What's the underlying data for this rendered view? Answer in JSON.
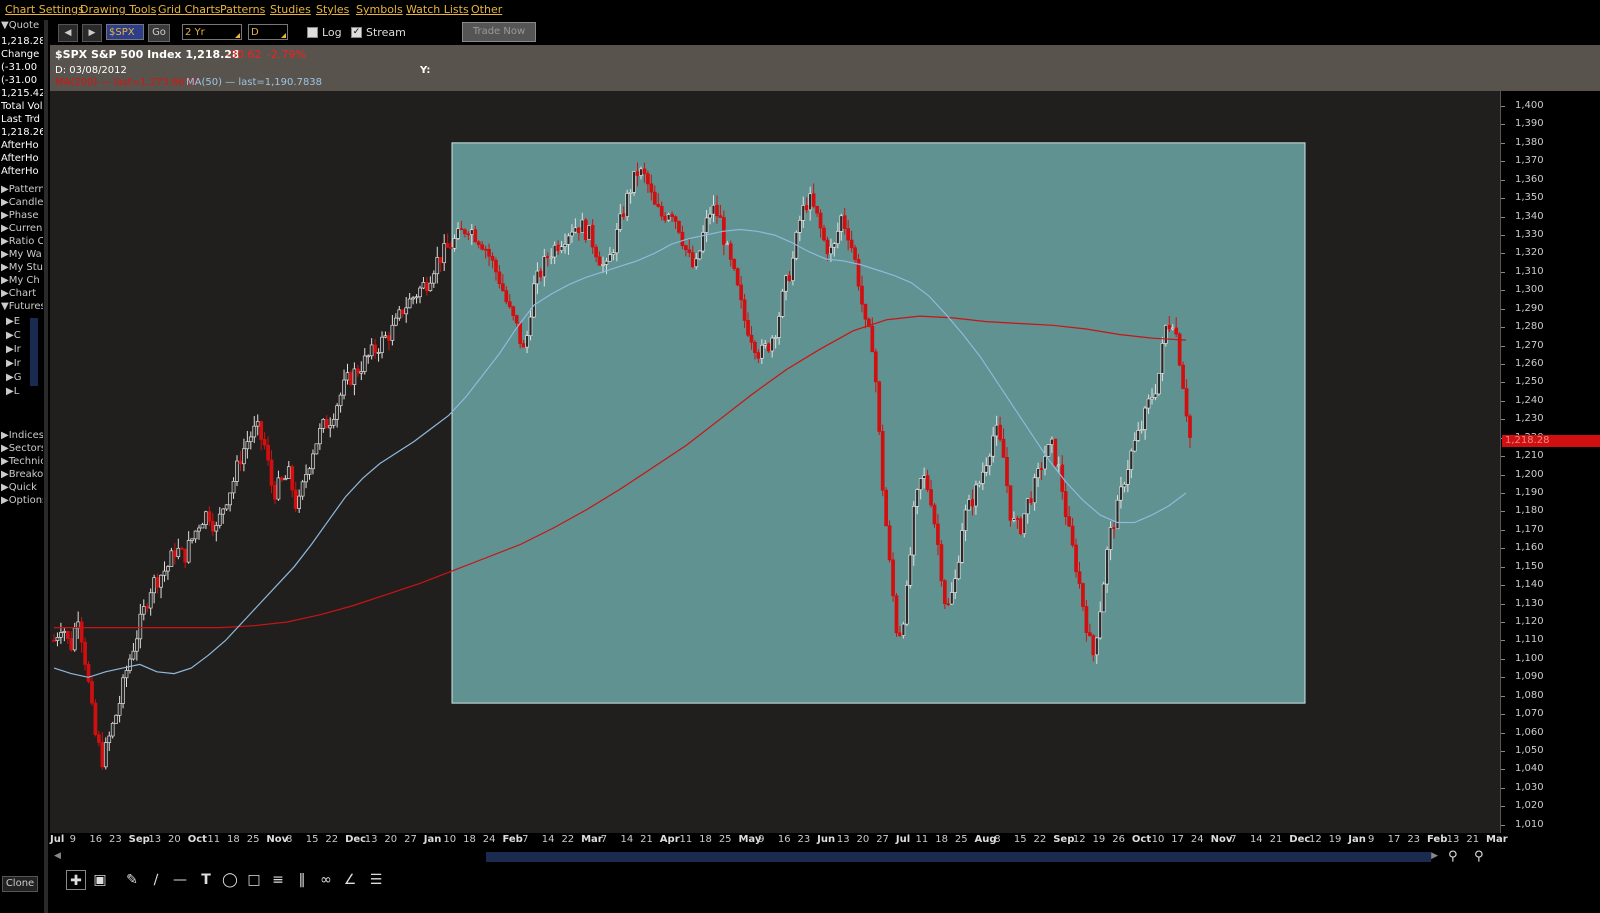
{
  "menu": [
    "Chart Settings",
    "Drawing Tools",
    "Grid Charts",
    "Patterns",
    "Studies",
    "Styles",
    "Symbols",
    "Watch Lists",
    "Other"
  ],
  "toolbar": {
    "symbol_value": "$SPX",
    "go_label": "Go",
    "range_value": "2 Yr",
    "period_value": "D",
    "log_label": "Log",
    "log_checked": false,
    "stream_label": "Stream",
    "stream_checked": true,
    "trade_label": "Trade Now"
  },
  "left_panel": {
    "quote_header": "Quote",
    "quote_rows": [
      "1,218.28",
      "Change",
      "(-31.00",
      "(-31.00",
      "1,215.42",
      "Total Vol",
      "Last Trd",
      "1,218.26",
      "AfterHo",
      "AfterHo",
      "AfterHo"
    ],
    "sections": [
      "Patterns",
      "Candle",
      "Phase",
      "Currency",
      "Ratio C",
      "My Wa",
      "My Stu",
      "My Ch",
      "Chart",
      "Futures"
    ],
    "futures_items": [
      "E",
      "C",
      "Ir",
      "Ir",
      "G",
      "L"
    ],
    "sections2": [
      "Indices",
      "Sectors",
      "Technic",
      "Breako",
      "Quick",
      "Options"
    ],
    "clone_label": "Clone"
  },
  "info": {
    "symbol_line": "$SPX S&P 500 Index  1,218.28",
    "change": "-30.62",
    "change_pct": "-2.79%",
    "date_line": "D: 03/08/2012",
    "y_label": "Y:",
    "ma200_label": "MA(200) — last=1,273.6632",
    "ma50_label": "MA(50) — last=1,190.7838"
  },
  "colors": {
    "up": "#e0e0e0",
    "down": "#d01010",
    "ma200": "#c81414",
    "ma50": "#8fb9dd",
    "highlight_box": "#5f9290",
    "chart_bg": "#211f1d"
  },
  "y_axis": {
    "ticks": [
      "1,400",
      "1,390",
      "1,380",
      "1,370",
      "1,360",
      "1,350",
      "1,340",
      "1,330",
      "1,320",
      "1,310",
      "1,300",
      "1,290",
      "1,280",
      "1,270",
      "1,260",
      "1,250",
      "1,240",
      "1,230",
      "1,220",
      "1,210",
      "1,200",
      "1,190",
      "1,180",
      "1,170",
      "1,160",
      "1,150",
      "1,140",
      "1,130",
      "1,120",
      "1,110",
      "1,100",
      "1,090",
      "1,080",
      "1,070",
      "1,060",
      "1,050",
      "1,040",
      "1,030",
      "1,020",
      "1,010"
    ],
    "last_value": "1,218.28"
  },
  "x_axis": {
    "labels": [
      {
        "t": "Jul",
        "m": true
      },
      {
        "t": "9"
      },
      {
        "t": "16"
      },
      {
        "t": "23"
      },
      {
        "t": "Sep",
        "m": true
      },
      {
        "t": "13"
      },
      {
        "t": "20"
      },
      {
        "t": "Oct",
        "m": true
      },
      {
        "t": "11"
      },
      {
        "t": "18"
      },
      {
        "t": "25"
      },
      {
        "t": "Nov",
        "m": true
      },
      {
        "t": "8"
      },
      {
        "t": "15"
      },
      {
        "t": "22"
      },
      {
        "t": "Dec",
        "m": true
      },
      {
        "t": "13"
      },
      {
        "t": "20"
      },
      {
        "t": "27"
      },
      {
        "t": "Jan",
        "m": true
      },
      {
        "t": "10"
      },
      {
        "t": "18"
      },
      {
        "t": "24"
      },
      {
        "t": "Feb",
        "m": true
      },
      {
        "t": "7"
      },
      {
        "t": "14"
      },
      {
        "t": "22"
      },
      {
        "t": "Mar",
        "m": true
      },
      {
        "t": "7"
      },
      {
        "t": "14"
      },
      {
        "t": "21"
      },
      {
        "t": "Apr",
        "m": true
      },
      {
        "t": "11"
      },
      {
        "t": "18"
      },
      {
        "t": "25"
      },
      {
        "t": "May",
        "m": true
      },
      {
        "t": "9"
      },
      {
        "t": "16"
      },
      {
        "t": "23"
      },
      {
        "t": "Jun",
        "m": true
      },
      {
        "t": "13"
      },
      {
        "t": "20"
      },
      {
        "t": "27"
      },
      {
        "t": "Jul",
        "m": true
      },
      {
        "t": "11"
      },
      {
        "t": "18"
      },
      {
        "t": "25"
      },
      {
        "t": "Aug",
        "m": true
      },
      {
        "t": "8"
      },
      {
        "t": "15"
      },
      {
        "t": "22"
      },
      {
        "t": "Sep",
        "m": true
      },
      {
        "t": "12"
      },
      {
        "t": "19"
      },
      {
        "t": "26"
      },
      {
        "t": "Oct",
        "m": true
      },
      {
        "t": "10"
      },
      {
        "t": "17"
      },
      {
        "t": "24"
      },
      {
        "t": "Nov",
        "m": true
      },
      {
        "t": "7"
      },
      {
        "t": "14"
      },
      {
        "t": "21"
      },
      {
        "t": "Dec",
        "m": true
      },
      {
        "t": "12"
      },
      {
        "t": "19"
      },
      {
        "t": "Jan",
        "m": true
      },
      {
        "t": "9"
      },
      {
        "t": "17"
      },
      {
        "t": "23"
      },
      {
        "t": "Feb",
        "m": true
      },
      {
        "t": "13"
      },
      {
        "t": "21"
      },
      {
        "t": "Mar",
        "m": true
      }
    ]
  },
  "price_path": [
    1110,
    1120,
    1105,
    1125,
    1095,
    1060,
    1045,
    1060,
    1075,
    1095,
    1110,
    1125,
    1140,
    1145,
    1150,
    1160,
    1155,
    1165,
    1175,
    1180,
    1170,
    1185,
    1195,
    1210,
    1220,
    1225,
    1215,
    1190,
    1195,
    1200,
    1180,
    1200,
    1215,
    1225,
    1230,
    1240,
    1250,
    1255,
    1260,
    1265,
    1270,
    1275,
    1280,
    1290,
    1295,
    1300,
    1305,
    1315,
    1320,
    1325,
    1330,
    1335,
    1330,
    1325,
    1315,
    1305,
    1290,
    1280,
    1265,
    1300,
    1310,
    1320,
    1325,
    1330,
    1335,
    1335,
    1330,
    1320,
    1310,
    1325,
    1340,
    1355,
    1365,
    1360,
    1345,
    1340,
    1345,
    1335,
    1320,
    1310,
    1330,
    1345,
    1340,
    1320,
    1305,
    1285,
    1275,
    1265,
    1270,
    1280,
    1300,
    1315,
    1340,
    1350,
    1340,
    1325,
    1320,
    1340,
    1330,
    1310,
    1280,
    1270,
    1200,
    1150,
    1110,
    1130,
    1180,
    1200,
    1190,
    1160,
    1125,
    1140,
    1175,
    1185,
    1195,
    1210,
    1225,
    1210,
    1175,
    1170,
    1185,
    1195,
    1210,
    1215,
    1200,
    1170,
    1150,
    1125,
    1100,
    1130,
    1165,
    1180,
    1200,
    1215,
    1225,
    1240,
    1250,
    1280,
    1285,
    1255,
    1220
  ],
  "ma50_path": [
    1095,
    1092,
    1090,
    1093,
    1095,
    1097,
    1093,
    1092,
    1095,
    1102,
    1110,
    1120,
    1130,
    1140,
    1150,
    1162,
    1175,
    1188,
    1198,
    1206,
    1212,
    1218,
    1225,
    1232,
    1242,
    1254,
    1266,
    1280,
    1292,
    1298,
    1303,
    1307,
    1310,
    1313,
    1316,
    1320,
    1325,
    1328,
    1330,
    1332,
    1333,
    1332,
    1330,
    1326,
    1321,
    1317,
    1316,
    1314,
    1311,
    1308,
    1304,
    1297,
    1287,
    1276,
    1264,
    1250,
    1236,
    1222,
    1208,
    1196,
    1186,
    1178,
    1174,
    1174,
    1178,
    1183,
    1190
  ],
  "ma200_path": [
    1117,
    1117,
    1117,
    1117,
    1117,
    1117,
    1118,
    1120,
    1124,
    1129,
    1135,
    1141,
    1148,
    1155,
    1162,
    1171,
    1181,
    1192,
    1204,
    1216,
    1230,
    1244,
    1257,
    1268,
    1278,
    1284,
    1286,
    1285,
    1283,
    1282,
    1281,
    1279,
    1276,
    1274,
    1273
  ],
  "highlight_box": {
    "price_top": 1380,
    "price_bottom": 1076
  }
}
